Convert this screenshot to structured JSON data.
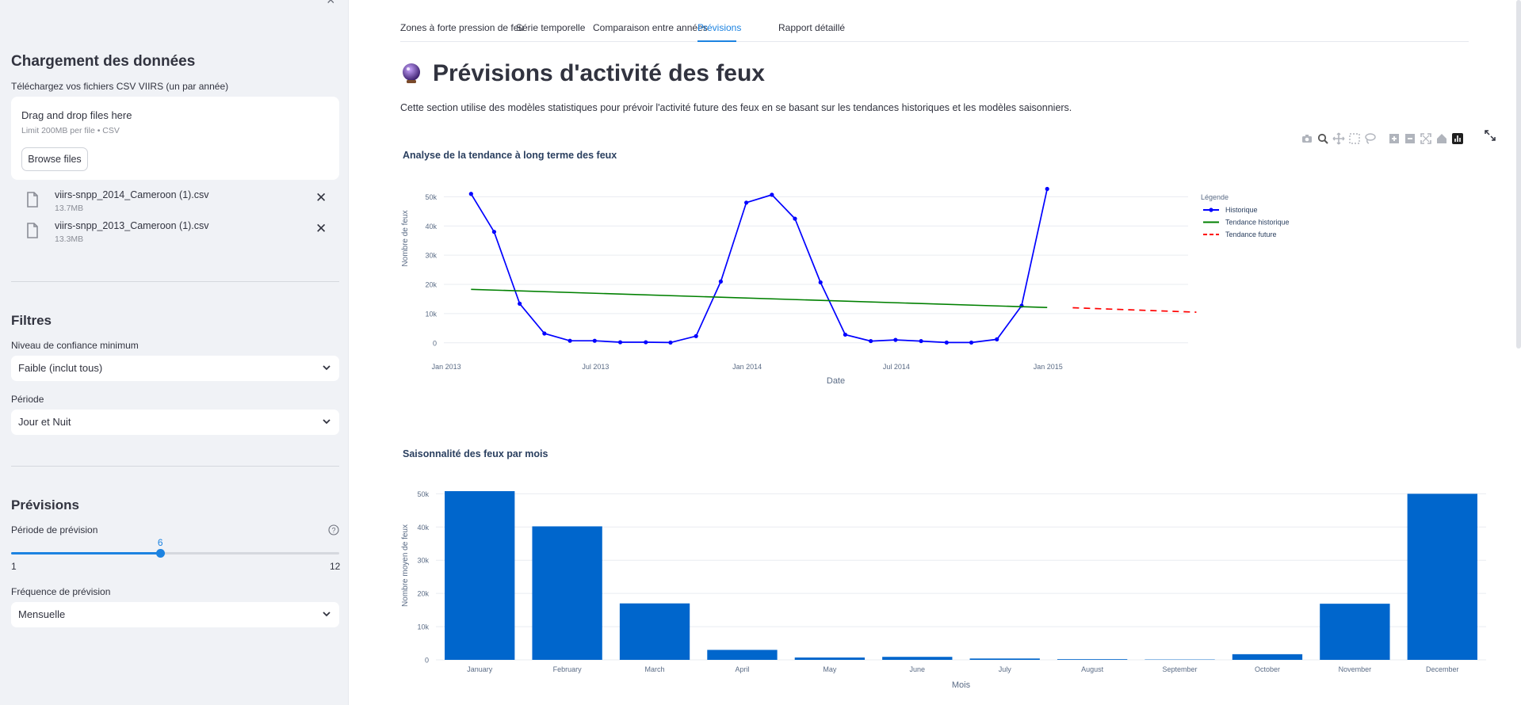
{
  "sidebar": {
    "data_loading": {
      "heading": "Chargement des données",
      "label": "Téléchargez vos fichiers CSV VIIRS (un par année)",
      "dropzone_title": "Drag and drop files here",
      "dropzone_limit": "Limit 200MB per file • CSV",
      "browse_label": "Browse files"
    },
    "files": [
      {
        "name": "viirs-snpp_2014_Cameroon (1).csv",
        "size": "13.7MB"
      },
      {
        "name": "viirs-snpp_2013_Cameroon (1).csv",
        "size": "13.3MB"
      }
    ],
    "filters": {
      "heading": "Filtres",
      "confidence_label": "Niveau de confiance minimum",
      "confidence_value": "Faible (inclut tous)",
      "period_label": "Période",
      "period_value": "Jour et Nuit"
    },
    "forecast": {
      "heading": "Prévisions",
      "period_label": "Période de prévision",
      "slider_value": "6",
      "slider_min": "1",
      "slider_max": "12",
      "slider_fraction": 0.4545,
      "frequency_label": "Fréquence de prévision",
      "frequency_value": "Mensuelle"
    }
  },
  "tabs": [
    {
      "label": "Zones à forte pression de feu",
      "active": false
    },
    {
      "label": "Série temporelle",
      "active": false
    },
    {
      "label": "Comparaison entre années",
      "active": false
    },
    {
      "label": "Prévisions",
      "active": true
    },
    {
      "label": "Rapport détaillé",
      "active": false
    }
  ],
  "main": {
    "title": "Prévisions d'activité des feux",
    "intro": "Cette section utilise des modèles statistiques pour prévoir l'activité future des feux en se basant sur les tendances historiques et les modèles saisonniers."
  },
  "modebar_icons": [
    "camera-icon",
    "zoom-icon",
    "pan-icon",
    "box-select-icon",
    "lasso-icon",
    "zoom-in-icon",
    "zoom-out-icon",
    "autoscale-icon",
    "reset-axes-icon",
    "plotly-logo-icon"
  ],
  "colors": {
    "accent": "#1c83e1",
    "historique": "#0000ff",
    "tendance": "#008000",
    "future": "#ff0000",
    "bars": "#0066cc"
  },
  "chart_data": [
    {
      "type": "line",
      "title": "Analyse de la tendance à long terme des feux",
      "xlabel": "Date",
      "ylabel": "Nombre de feux",
      "ylim": [
        -2500,
        55000
      ],
      "xlim": [
        "2012-12-29",
        "2015-06-20"
      ],
      "yticks": [
        0,
        10000,
        20000,
        30000,
        40000,
        50000
      ],
      "ytick_labels": [
        "0",
        "10k",
        "20k",
        "30k",
        "40k",
        "50k"
      ],
      "xticks": [
        "2013-01-01",
        "2013-07-01",
        "2014-01-01",
        "2014-07-01",
        "2015-01-01"
      ],
      "xtick_labels": [
        "Jan 2013",
        "Jul 2013",
        "Jan 2014",
        "Jul 2014",
        "Jan 2015"
      ],
      "grid": true,
      "legend": {
        "title": "Légende",
        "position": "top-right"
      },
      "series": [
        {
          "name": "Historique",
          "style": "lines+markers",
          "color": "#0000ff",
          "x": [
            "2013-01-31",
            "2013-02-28",
            "2013-03-31",
            "2013-04-30",
            "2013-05-31",
            "2013-06-30",
            "2013-07-31",
            "2013-08-31",
            "2013-09-30",
            "2013-10-31",
            "2013-11-30",
            "2013-12-31",
            "2014-01-31",
            "2014-02-28",
            "2014-03-31",
            "2014-04-30",
            "2014-05-31",
            "2014-06-30",
            "2014-07-31",
            "2014-08-31",
            "2014-09-30",
            "2014-10-31",
            "2014-11-30",
            "2014-12-31"
          ],
          "y": [
            51000,
            38000,
            13400,
            3200,
            700,
            700,
            200,
            200,
            100,
            2300,
            21000,
            48000,
            50700,
            42500,
            20700,
            2800,
            600,
            1000,
            600,
            100,
            100,
            1200,
            12700,
            52700
          ]
        },
        {
          "name": "Tendance historique",
          "style": "lines",
          "color": "#008000",
          "x": [
            "2013-01-31",
            "2014-12-31"
          ],
          "y": [
            18300,
            12100
          ]
        },
        {
          "name": "Tendance future",
          "style": "dash",
          "color": "#ff0000",
          "x": [
            "2015-01-31",
            "2015-06-30"
          ],
          "y": [
            12000,
            10500
          ]
        }
      ]
    },
    {
      "type": "bar",
      "title": "Saisonnalité des feux par mois",
      "xlabel": "Mois",
      "ylabel": "Nombre moyen de feux",
      "ylim": [
        0,
        52000
      ],
      "yticks": [
        0,
        10000,
        20000,
        30000,
        40000,
        50000
      ],
      "ytick_labels": [
        "0",
        "10k",
        "20k",
        "30k",
        "40k",
        "50k"
      ],
      "grid": true,
      "color": "#0066cc",
      "categories": [
        "January",
        "February",
        "March",
        "April",
        "May",
        "June",
        "July",
        "August",
        "September",
        "October",
        "November",
        "December"
      ],
      "values": [
        50800,
        40200,
        17000,
        3000,
        700,
        900,
        400,
        200,
        100,
        1700,
        16900,
        50000
      ]
    }
  ]
}
